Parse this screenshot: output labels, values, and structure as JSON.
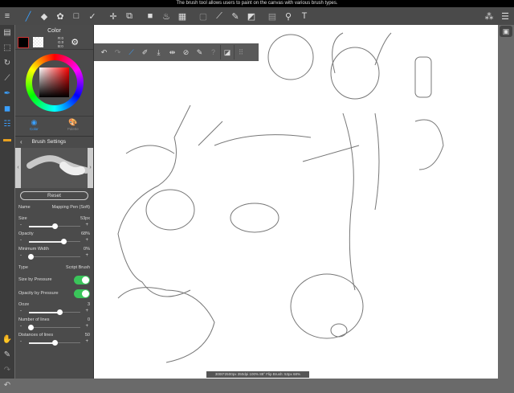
{
  "tooltip": "The brush tool allows users to paint on the canvas with various brush types.",
  "toolbar": {
    "icons": [
      "menu-icon",
      "brush-icon",
      "eraser-icon",
      "blur-icon",
      "selection-rect-icon",
      "check-icon",
      "move-icon",
      "transform-icon",
      "fill-rect-icon",
      "bucket-icon",
      "gradient-icon",
      "select-area-icon",
      "eyedropper-icon",
      "pen-select-icon",
      "lasso-fill-icon",
      "frame-icon",
      "zoom-icon",
      "text-icon"
    ]
  },
  "color_panel": {
    "title": "Color",
    "rgb": [
      "R:0",
      "G:0",
      "B:0"
    ],
    "tabs": [
      "Color",
      "Palette"
    ],
    "main_color": "#000000"
  },
  "brush_settings": {
    "title": "Brush Settings",
    "reset": "Reset",
    "name_label": "Name",
    "name_value": "Mapping Pen (Soft)",
    "size_label": "Size",
    "size_value": "53px",
    "size_fraction": 0.5,
    "opacity_label": "Opacity",
    "opacity_value": "68%",
    "opacity_fraction": 0.68,
    "minwidth_label": "Minimum Width",
    "minwidth_value": "0%",
    "minwidth_fraction": 0.0,
    "type_label": "Type",
    "type_value": "Script Brush",
    "size_pressure_label": "Size by Pressure",
    "opacity_pressure_label": "Opacity by Pressure",
    "ooze_label": "Ooze",
    "ooze_value": "3",
    "ooze_fraction": 0.6,
    "lines_label": "Number of lines",
    "lines_value": "0",
    "lines_fraction": 0.0,
    "distance_label": "Distances of lines",
    "distance_value": "50",
    "distance_fraction": 0.5
  },
  "status": "3000*2500px 350dpi 100% 88° Flip Brush: 53px 68%"
}
